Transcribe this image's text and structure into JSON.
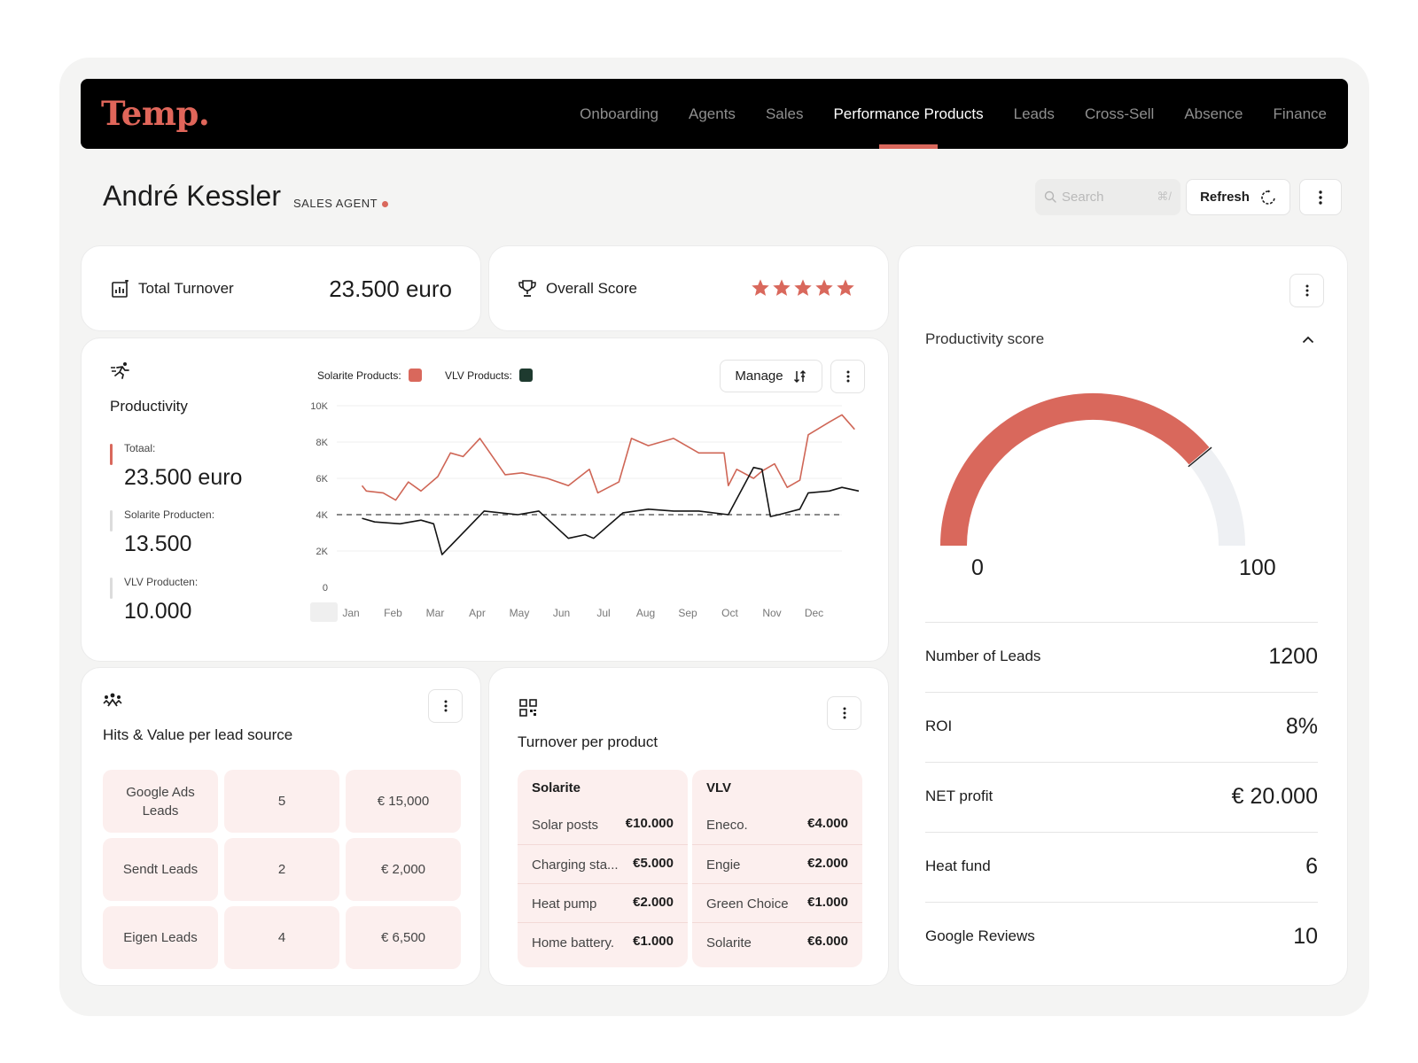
{
  "brand": {
    "logo": "Temp.",
    "accent": "#d9685c",
    "dark_green": "#1e3a2f"
  },
  "nav": {
    "items": [
      {
        "label": "Onboarding",
        "active": false
      },
      {
        "label": "Agents",
        "active": false
      },
      {
        "label": "Sales",
        "active": false
      },
      {
        "label": "Performance Products",
        "active": true
      },
      {
        "label": "Leads",
        "active": false
      },
      {
        "label": "Cross-Sell",
        "active": false
      },
      {
        "label": "Absence",
        "active": false
      },
      {
        "label": "Finance",
        "active": false
      }
    ]
  },
  "header": {
    "user_name": "André Kessler",
    "role": "SALES AGENT",
    "search_placeholder": "Search",
    "search_shortcut": "⌘/",
    "refresh_label": "Refresh"
  },
  "total_turnover": {
    "label": "Total Turnover",
    "value": "23.500 euro",
    "icon": "chart-icon"
  },
  "overall_score": {
    "label": "Overall Score",
    "stars": 5,
    "max": 5,
    "icon": "trophy-icon"
  },
  "productivity": {
    "title": "Productivity",
    "total_label": "Totaal:",
    "total_value": "23.500 euro",
    "solarite_label": "Solarite Producten:",
    "solarite_value": "13.500",
    "vlv_label": "VLV Producten:",
    "vlv_value": "10.000",
    "manage_label": "Manage",
    "legend_solarite": "Solarite Products:",
    "legend_vlv": "VLV Products:"
  },
  "chart_data": {
    "type": "line",
    "x_labels": [
      "Jan",
      "Feb",
      "Mar",
      "Apr",
      "May",
      "Jun",
      "Jul",
      "Aug",
      "Sep",
      "Oct",
      "Nov",
      "Dec"
    ],
    "y_ticks": [
      {
        "value": 0,
        "label": "0"
      },
      {
        "value": 2000,
        "label": "2K"
      },
      {
        "value": 4000,
        "label": "4K"
      },
      {
        "value": 6000,
        "label": "6K"
      },
      {
        "value": 8000,
        "label": "8K"
      },
      {
        "value": 10000,
        "label": "10K"
      }
    ],
    "ylim": [
      0,
      10000
    ],
    "xlim": [
      0,
      12
    ],
    "grid": true,
    "reference_line": 4000,
    "series": [
      {
        "name": "Solarite Products",
        "color": "#cf6656",
        "points": [
          [
            0.6,
            5600
          ],
          [
            0.7,
            5300
          ],
          [
            1.1,
            5200
          ],
          [
            1.4,
            4800
          ],
          [
            1.7,
            5800
          ],
          [
            2.0,
            5300
          ],
          [
            2.4,
            6100
          ],
          [
            2.7,
            7400
          ],
          [
            3.0,
            7200
          ],
          [
            3.4,
            8200
          ],
          [
            4.0,
            6200
          ],
          [
            4.4,
            6300
          ],
          [
            5.0,
            6000
          ],
          [
            5.5,
            5600
          ],
          [
            6.0,
            6500
          ],
          [
            6.2,
            5200
          ],
          [
            6.7,
            5800
          ],
          [
            7.0,
            8200
          ],
          [
            7.4,
            7800
          ],
          [
            8.0,
            8200
          ],
          [
            8.6,
            7400
          ],
          [
            9.2,
            7400
          ],
          [
            9.3,
            5600
          ],
          [
            9.5,
            6500
          ],
          [
            9.9,
            6000
          ],
          [
            10.1,
            6400
          ],
          [
            10.4,
            6800
          ],
          [
            10.7,
            5500
          ],
          [
            11.0,
            5900
          ],
          [
            11.2,
            8400
          ],
          [
            11.7,
            9100
          ],
          [
            12.0,
            9500
          ],
          [
            12.3,
            8700
          ]
        ]
      },
      {
        "name": "VLV Products",
        "color": "#141414",
        "points": [
          [
            0.6,
            3800
          ],
          [
            0.9,
            3600
          ],
          [
            1.5,
            3500
          ],
          [
            2.0,
            3700
          ],
          [
            2.3,
            3500
          ],
          [
            2.5,
            1800
          ],
          [
            3.5,
            4200
          ],
          [
            4.3,
            4000
          ],
          [
            4.8,
            4200
          ],
          [
            5.5,
            2700
          ],
          [
            5.9,
            2900
          ],
          [
            6.1,
            2700
          ],
          [
            6.8,
            4100
          ],
          [
            7.4,
            4300
          ],
          [
            8.0,
            4200
          ],
          [
            8.6,
            4200
          ],
          [
            9.3,
            4000
          ],
          [
            9.9,
            6600
          ],
          [
            10.1,
            6500
          ],
          [
            10.3,
            3900
          ],
          [
            10.5,
            4000
          ],
          [
            11.0,
            4300
          ],
          [
            11.2,
            5200
          ],
          [
            11.7,
            5300
          ],
          [
            12.0,
            5500
          ],
          [
            12.4,
            5300
          ]
        ]
      }
    ]
  },
  "lead_sources": {
    "title": "Hits & Value per lead source",
    "rows": [
      {
        "source": "Google Ads Leads",
        "hits": "5",
        "value": "€ 15,000"
      },
      {
        "source": "Sendt Leads",
        "hits": "2",
        "value": "€ 2,000"
      },
      {
        "source": "Eigen Leads",
        "hits": "4",
        "value": "€ 6,500"
      }
    ]
  },
  "turnover_product": {
    "title": "Turnover per product",
    "groups": [
      {
        "name": "Solarite",
        "items": [
          {
            "name": "Solar posts",
            "value": "€10.000"
          },
          {
            "name": "Charging sta...",
            "value": "€5.000"
          },
          {
            "name": "Heat pump",
            "value": "€2.000"
          },
          {
            "name": "Home battery.",
            "value": "€1.000"
          }
        ]
      },
      {
        "name": "VLV",
        "items": [
          {
            "name": "Eneco.",
            "value": "€4.000"
          },
          {
            "name": "Engie",
            "value": "€2.000"
          },
          {
            "name": "Green Choice",
            "value": "€1.000"
          },
          {
            "name": "Solarite",
            "value": "€6.000"
          }
        ]
      }
    ]
  },
  "productivity_score": {
    "title": "Productivity score",
    "min_label": "0",
    "max_label": "100",
    "fraction": 0.78,
    "colors": {
      "fill": "#d9685c",
      "track": "#eef0f3"
    }
  },
  "metrics": [
    {
      "label": "Number of Leads",
      "value": "1200"
    },
    {
      "label": "ROI",
      "value": "8%"
    },
    {
      "label": "NET profit",
      "value": "€ 20.000"
    },
    {
      "label": "Heat fund",
      "value": "6"
    },
    {
      "label": "Google Reviews",
      "value": "10"
    }
  ]
}
